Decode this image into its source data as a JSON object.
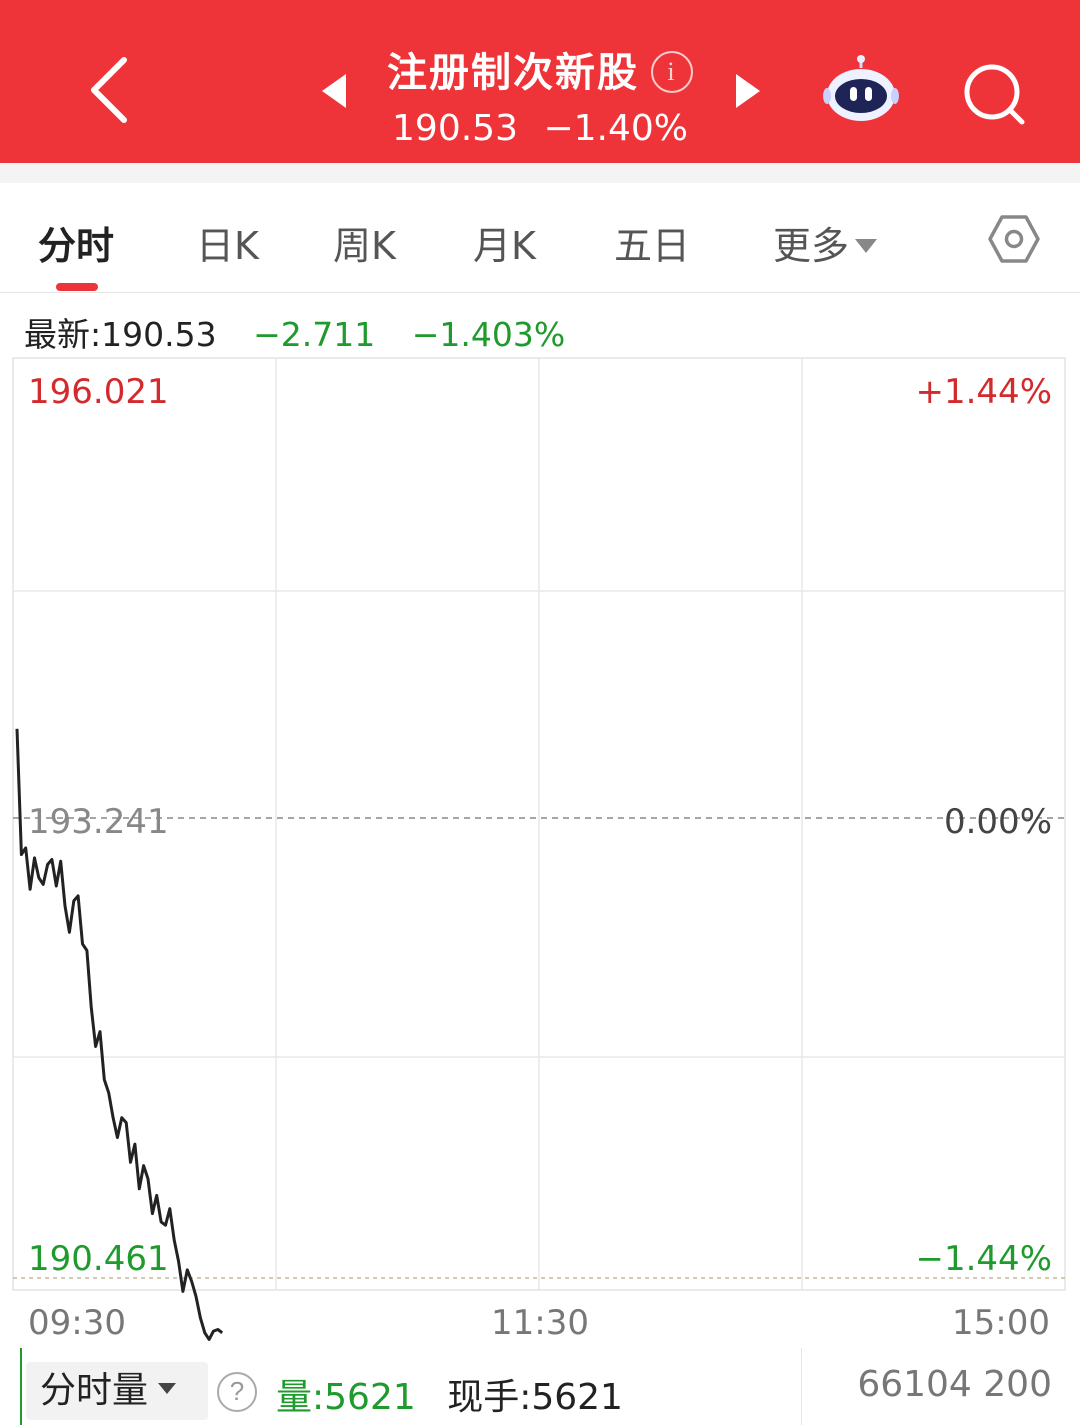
{
  "header": {
    "title": "注册制次新股",
    "info_icon": "i",
    "price": "190.53",
    "change_pct": "−1.40%",
    "icons": {
      "back": "chevron-left-icon",
      "prev": "triangle-left-icon",
      "next": "triangle-right-icon",
      "assistant": "robot-icon",
      "search": "search-icon"
    },
    "bg_color": "#ee3439"
  },
  "tabs": [
    {
      "label": "分时",
      "active": true
    },
    {
      "label": "日K",
      "active": false
    },
    {
      "label": "周K",
      "active": false
    },
    {
      "label": "月K",
      "active": false
    },
    {
      "label": "五日",
      "active": false
    },
    {
      "label": "更多",
      "active": false
    }
  ],
  "info": {
    "latest_label": "最新:",
    "latest_value": "190.53",
    "change": "−2.711",
    "change_pct": "−1.403%"
  },
  "chart_data": {
    "type": "line",
    "y_top_label": "196.021",
    "y_mid_label": "193.241",
    "y_bottom_label": "190.461",
    "pct_top_label": "+1.44%",
    "pct_mid_label": "0.00%",
    "pct_bottom_label": "−1.44%",
    "ylim": [
      190.461,
      196.021
    ],
    "prev_close": 193.241,
    "x_labels": [
      "09:30",
      "11:30",
      "15:00"
    ],
    "total_minutes": 240,
    "x_minutes": [
      0,
      1,
      2,
      3,
      4,
      5,
      6,
      7,
      8,
      9,
      10,
      11,
      12,
      13,
      14,
      15,
      16,
      17,
      18,
      19,
      20,
      21,
      22,
      23,
      24,
      25,
      26,
      27,
      28,
      29,
      30,
      31,
      32,
      33,
      34,
      35,
      36,
      37,
      38,
      39,
      40,
      41,
      42,
      43,
      44,
      45,
      46,
      47
    ],
    "y": [
      193.78,
      193.02,
      193.06,
      192.81,
      193.0,
      192.88,
      192.84,
      192.96,
      192.99,
      192.83,
      192.98,
      192.71,
      192.55,
      192.74,
      192.77,
      192.48,
      192.44,
      192.1,
      191.86,
      191.95,
      191.66,
      191.58,
      191.43,
      191.31,
      191.43,
      191.4,
      191.16,
      191.27,
      191.0,
      191.14,
      191.06,
      190.85,
      190.96,
      190.8,
      190.78,
      190.88,
      190.69,
      190.56,
      190.38,
      190.51,
      190.44,
      190.35,
      190.22,
      190.13,
      190.09,
      190.14,
      190.15,
      190.13
    ],
    "grid": true,
    "line_color": "#222222",
    "up_color": "#d32a2e",
    "down_color": "#1f9a2c"
  },
  "volume": {
    "selector_label": "分时量",
    "help": "?",
    "vol_label": "量:5621",
    "hand_label": "现手:5621",
    "max_label": "66104 200"
  }
}
